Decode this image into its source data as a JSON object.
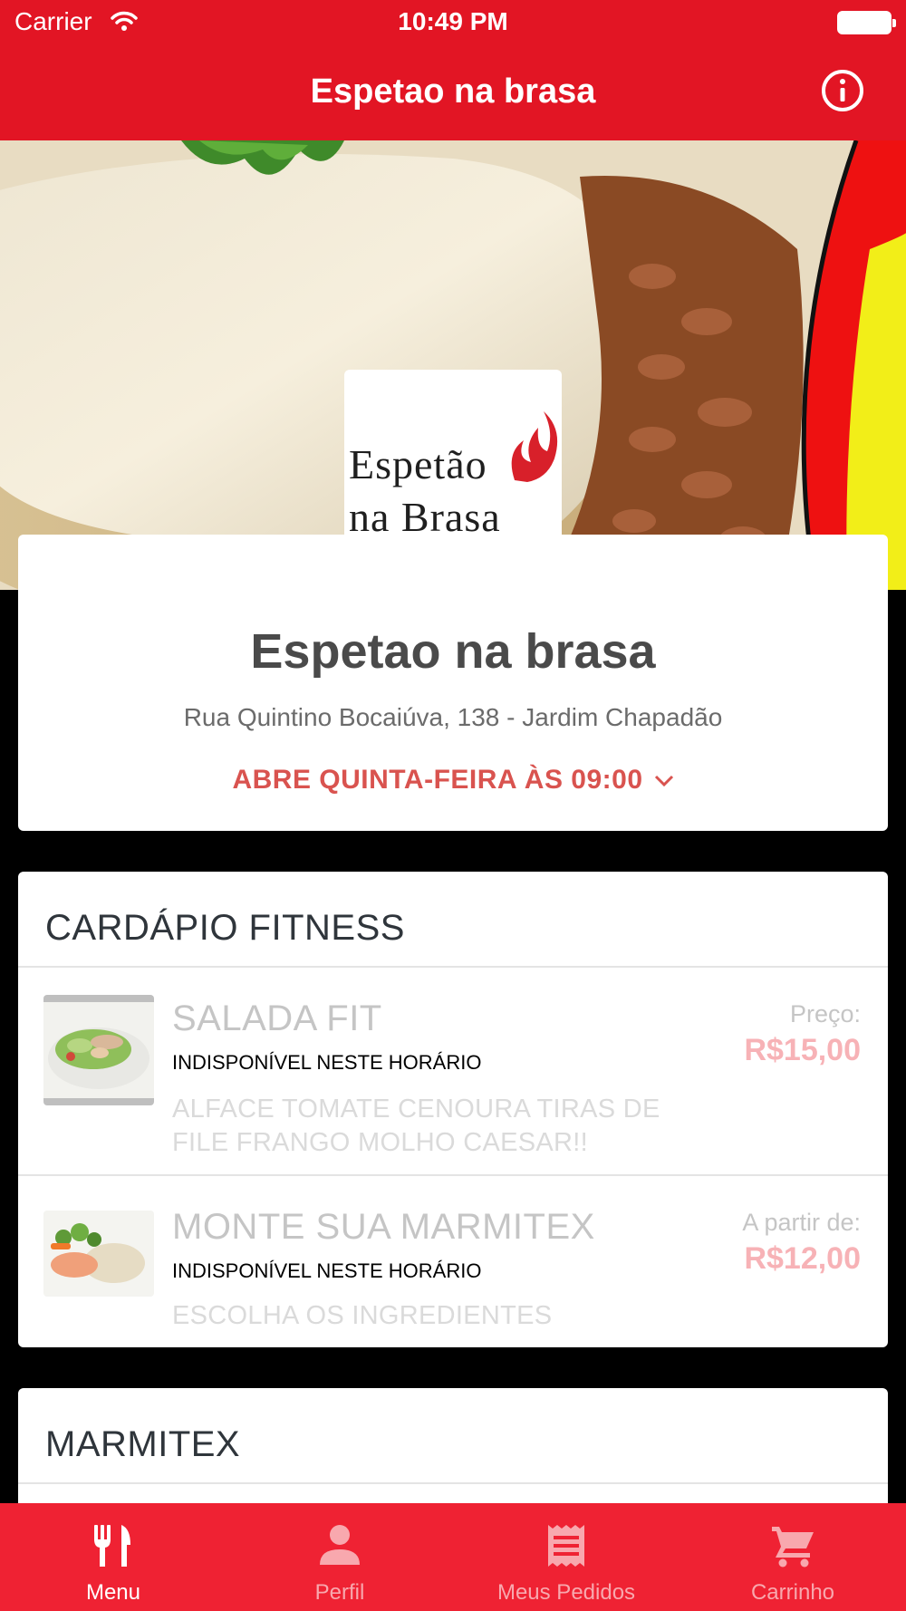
{
  "status_bar": {
    "carrier": "Carrier",
    "time": "10:49 PM"
  },
  "nav": {
    "title": "Espetao na brasa",
    "info_icon": "info-circle-icon"
  },
  "restaurant": {
    "logo_line1": "Espetão",
    "logo_line2": "na Brasa",
    "name": "Espetao na brasa",
    "address": "Rua Quintino Bocaiúva, 138 - Jardim Chapadão",
    "hours": "ABRE QUINTA-FEIRA ÀS 09:00"
  },
  "categories": [
    {
      "title": "CARDÁPIO FITNESS",
      "items": [
        {
          "name": "SALADA FIT",
          "status": "INDISPONÍVEL NESTE HORÁRIO",
          "description": "ALFACE TOMATE CENOURA TIRAS DE FILE FRANGO MOLHO CAESAR!!",
          "price_label": "Preço:",
          "price": "R$15,00"
        },
        {
          "name": "MONTE SUA MARMITEX",
          "status": "INDISPONÍVEL NESTE HORÁRIO",
          "description": "ESCOLHA OS INGREDIENTES",
          "price_label": "A partir de:",
          "price": "R$12,00"
        }
      ]
    },
    {
      "title": "MARMITEX"
    }
  ],
  "tabs": [
    {
      "label": "Menu",
      "icon": "fork-knife-icon",
      "active": true
    },
    {
      "label": "Perfil",
      "icon": "person-icon",
      "active": false
    },
    {
      "label": "Meus Pedidos",
      "icon": "receipt-icon",
      "active": false
    },
    {
      "label": "Carrinho",
      "icon": "cart-icon",
      "active": false
    }
  ],
  "colors": {
    "brand_red": "#e21524",
    "tab_red": "#ef2233",
    "hours_red": "#d9534f",
    "price_pink": "#f7b2b6"
  }
}
